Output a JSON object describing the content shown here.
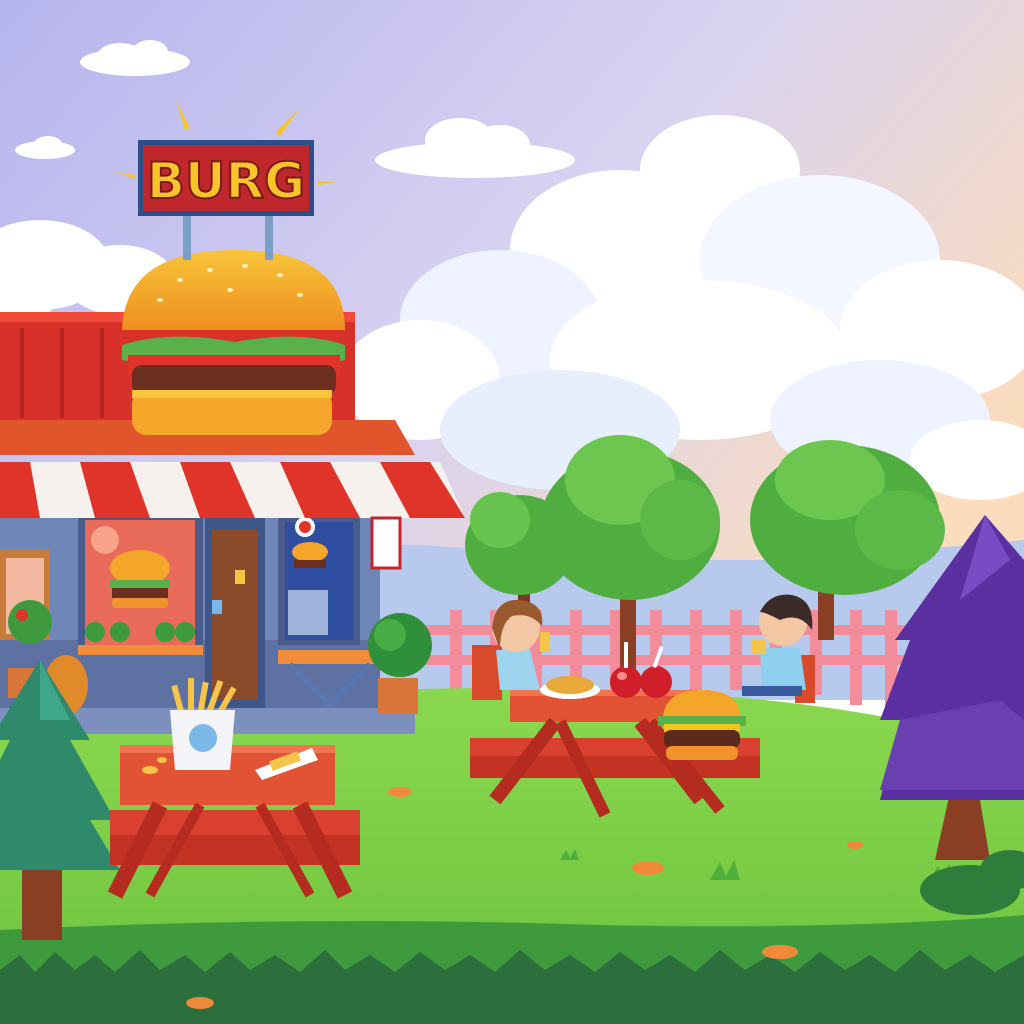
{
  "scene": {
    "sign": {
      "text": "BURG"
    },
    "colors": {
      "sky_top": "#b9b8ef",
      "sky_mid": "#d8d4f0",
      "sky_warm": "#f8dcc0",
      "grass": "#7fd14a",
      "grass_dark": "#3f8f3a",
      "grass_edge": "#2e6b3c",
      "shop_red": "#e0342a",
      "awning_white": "#f6f1ec",
      "bun": "#f4a62a",
      "lettuce": "#5ab04a",
      "patty": "#6b2f20",
      "table_red": "#d9402f",
      "fence": "#f28b9a",
      "tree_green": "#5dbb45",
      "tree_purple": "#6a3fb0",
      "trunk": "#8a3f24",
      "sign_yellow": "#f7c52a",
      "sign_red": "#c0272d"
    },
    "icons": [
      "burger-sign-icon",
      "fries-icon",
      "soda-cups-icon",
      "burger-on-table-icon",
      "mini-burger-icon"
    ]
  }
}
